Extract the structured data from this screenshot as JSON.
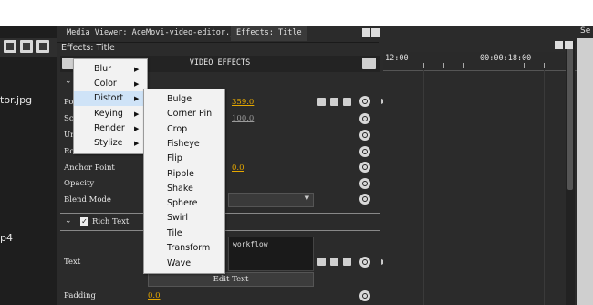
{
  "top_right_label": "Se",
  "tabs": [
    {
      "label": "Media Viewer: AceMovi-video-editor.jpg"
    },
    {
      "label": "Effects: Title"
    }
  ],
  "panel": {
    "title": "Effects: Title",
    "header": "VIDEO EFFECTS"
  },
  "left_files": [
    "tor.jpg",
    "p4"
  ],
  "properties": {
    "rows": [
      {
        "label": "Po",
        "value": "359.0"
      },
      {
        "label": "Sc",
        "value": "100.0"
      },
      {
        "label": "Un",
        "value": ""
      },
      {
        "label": "Ro",
        "value": ""
      },
      {
        "label": "Anchor Point",
        "value": "0.0"
      },
      {
        "label": "Opacity",
        "value": ""
      },
      {
        "label": "Blend Mode",
        "value": ""
      }
    ],
    "section": "Rich Text",
    "text_label": "Text",
    "text_value": "workflow",
    "edit_button": "Edit Text",
    "padding_label": "Padding",
    "padding_value": "0.0"
  },
  "timeline": {
    "time_start": "12:00",
    "time_mid": "00:00:18:00"
  },
  "menu": {
    "items": [
      "Blur",
      "Color",
      "Distort",
      "Keying",
      "Render",
      "Stylize"
    ],
    "highlighted": "Distort"
  },
  "submenu": {
    "items": [
      "Bulge",
      "Corner Pin",
      "Crop",
      "Fisheye",
      "Flip",
      "Ripple",
      "Shake",
      "Sphere",
      "Swirl",
      "Tile",
      "Transform",
      "Wave"
    ]
  },
  "colors": {
    "accent_value": "#e6a800",
    "menu_highlight": "#cfe3f7",
    "panel_bg": "#2b2b2b"
  }
}
